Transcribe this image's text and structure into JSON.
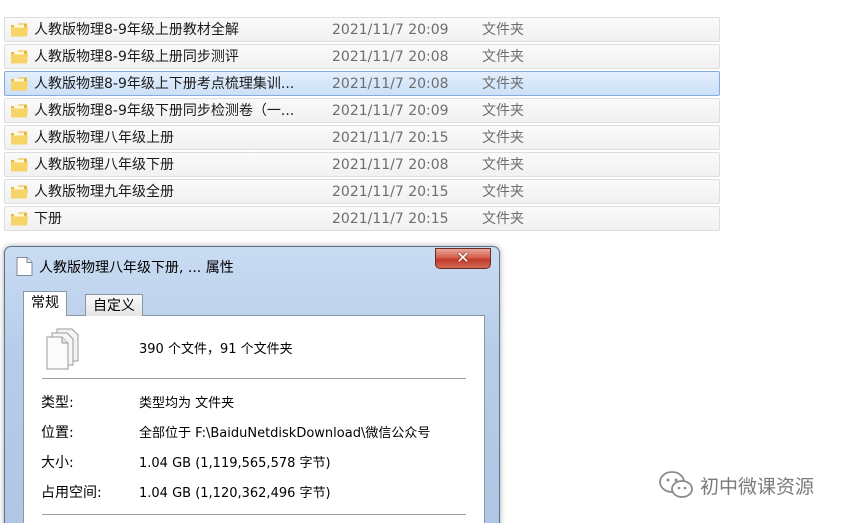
{
  "file_list": {
    "rows": [
      {
        "name": "人教版物理8-9年级上册教材全解",
        "date": "2021/11/7 20:09",
        "type": "文件夹",
        "selected": false
      },
      {
        "name": "人教版物理8-9年级上册同步测评",
        "date": "2021/11/7 20:08",
        "type": "文件夹",
        "selected": false
      },
      {
        "name": "人教版物理8-9年级上下册考点梳理集训...",
        "date": "2021/11/7 20:08",
        "type": "文件夹",
        "selected": true
      },
      {
        "name": "人教版物理8-9年级下册同步检测卷（一...",
        "date": "2021/11/7 20:09",
        "type": "文件夹",
        "selected": false
      },
      {
        "name": "人教版物理八年级上册",
        "date": "2021/11/7 20:15",
        "type": "文件夹",
        "selected": false
      },
      {
        "name": "人教版物理八年级下册",
        "date": "2021/11/7 20:08",
        "type": "文件夹",
        "selected": false
      },
      {
        "name": "人教版物理九年级全册",
        "date": "2021/11/7 20:15",
        "type": "文件夹",
        "selected": false
      },
      {
        "name": "下册",
        "date": "2021/11/7 20:15",
        "type": "文件夹",
        "selected": false
      }
    ]
  },
  "dialog": {
    "title": "人教版物理八年级下册, ... 属性",
    "close_label": "✕",
    "tabs": [
      {
        "label": "常规",
        "active": true
      },
      {
        "label": "自定义",
        "active": false
      }
    ],
    "summary": "390 个文件，91 个文件夹",
    "properties": [
      {
        "label": "类型:",
        "value": "类型均为 文件夹"
      },
      {
        "label": "位置:",
        "value": "全部位于 F:\\BaiduNetdiskDownload\\微信公众号"
      },
      {
        "label": "大小:",
        "value": "1.04 GB (1,119,565,578 字节)"
      },
      {
        "label": "占用空间:",
        "value": "1.04 GB (1,120,362,496 字节)"
      }
    ]
  },
  "watermark": {
    "text": "初中微课资源",
    "icon": "wechat-icon"
  },
  "colors": {
    "selection_bg": "#cbe0f8",
    "selection_border": "#84acdd",
    "folder_yellow": "#f3c94c",
    "close_red": "#c0392b"
  }
}
